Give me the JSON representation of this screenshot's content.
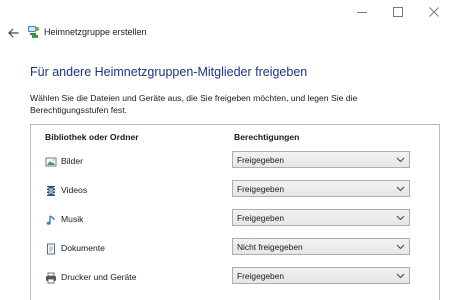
{
  "window": {
    "title": "Heimnetzgruppe erstellen"
  },
  "page": {
    "heading": "Für andere Heimnetzgruppen-Mitglieder freigeben",
    "description": "Wählen Sie die Dateien und Geräte aus, die Sie freigeben möchten, und legen Sie die Berechtigungsstufen fest."
  },
  "table": {
    "col_library": "Bibliothek oder Ordner",
    "col_permissions": "Berechtigungen",
    "rows": [
      {
        "label": "Bilder",
        "icon": "pictures-icon",
        "permission": "Freigegeben"
      },
      {
        "label": "Videos",
        "icon": "videos-icon",
        "permission": "Freigegeben"
      },
      {
        "label": "Musik",
        "icon": "music-icon",
        "permission": "Freigegeben"
      },
      {
        "label": "Dokumente",
        "icon": "documents-icon",
        "permission": "Nicht freigegeben"
      },
      {
        "label": "Drucker und Geräte",
        "icon": "printer-icon",
        "permission": "Freigegeben"
      }
    ]
  },
  "colors": {
    "heading": "#1e3287",
    "border": "#b9b9b9"
  }
}
